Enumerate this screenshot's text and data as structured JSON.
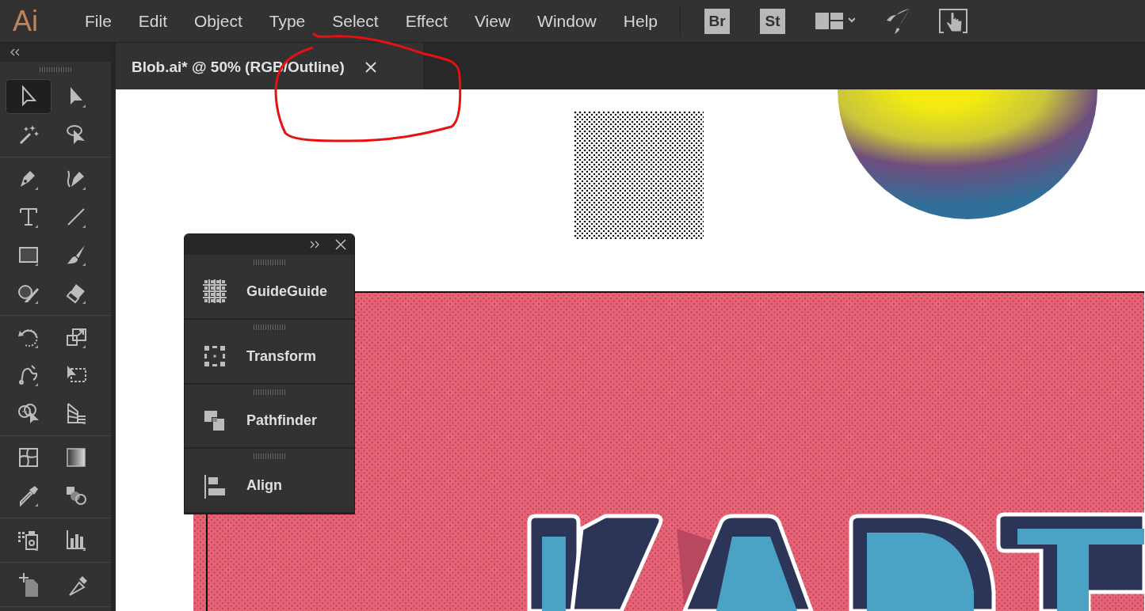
{
  "app": {
    "logo": "Ai"
  },
  "menu": [
    "File",
    "Edit",
    "Object",
    "Type",
    "Select",
    "Effect",
    "View",
    "Window",
    "Help"
  ],
  "app_buttons": [
    {
      "label": "Br"
    },
    {
      "label": "St"
    }
  ],
  "toolbar": {
    "groups": [
      [
        {
          "selected": true
        },
        {
          "selected": false
        },
        {
          "selected": false
        },
        {
          "selected": false
        }
      ],
      [
        {
          "selected": false
        },
        {
          "selected": false
        },
        {
          "selected": false
        },
        {
          "selected": false
        },
        {
          "selected": false
        },
        {
          "selected": false
        },
        {
          "selected": false
        },
        {
          "selected": false
        }
      ],
      [
        {
          "selected": false
        },
        {
          "selected": false
        },
        {
          "selected": false
        },
        {
          "selected": false
        },
        {
          "selected": false
        },
        {
          "selected": false
        }
      ],
      [
        {
          "selected": false
        },
        {
          "selected": false
        },
        {
          "selected": false
        },
        {
          "selected": false
        }
      ],
      [
        {
          "selected": false
        },
        {
          "selected": false
        }
      ],
      [
        {
          "selected": false
        },
        {
          "selected": false
        }
      ]
    ]
  },
  "document_tab": {
    "title": "Blob.ai* @ 50% (RGB/Outline)",
    "selected": true
  },
  "panel": {
    "items": [
      {
        "label": "GuideGuide"
      },
      {
        "label": "Transform"
      },
      {
        "label": "Pathfinder"
      },
      {
        "label": "Align"
      }
    ]
  }
}
